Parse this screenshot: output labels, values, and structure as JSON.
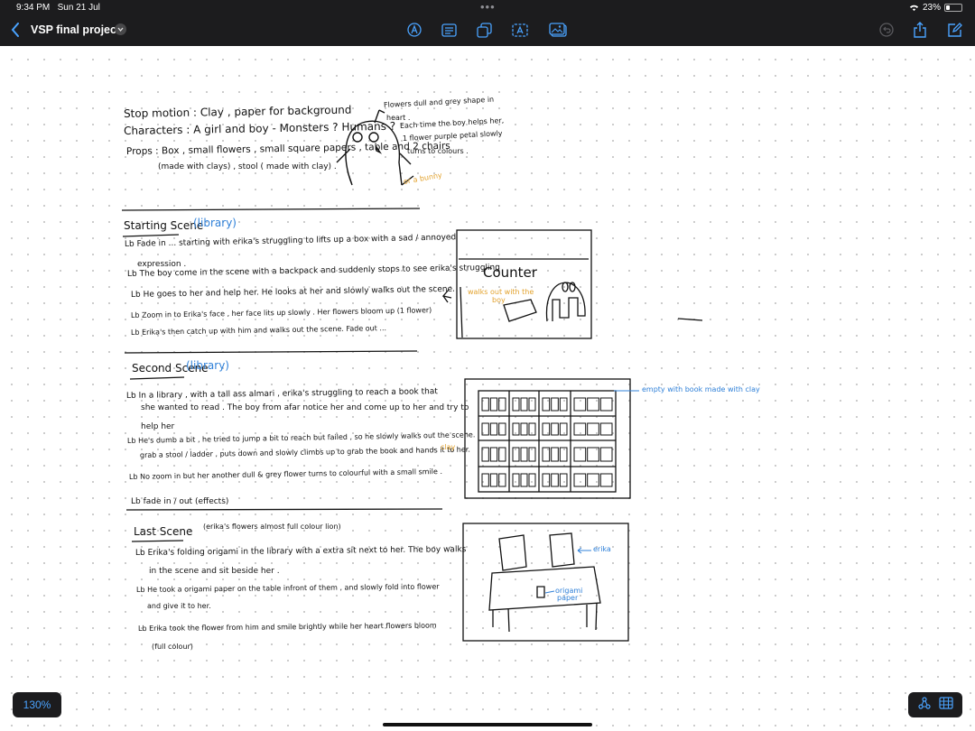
{
  "status_bar": {
    "time": "9:34 PM",
    "date": "Sun 21 Jul",
    "dots": "•••",
    "battery": "23%",
    "battery_level": 0.23
  },
  "toolbar": {
    "back_icon": "chevron-left-icon",
    "title": "VSP final project",
    "tools": [
      "pen-tip-icon",
      "text-format-icon",
      "shapes-icon",
      "text-box-icon",
      "media-icon"
    ],
    "right": [
      "undo-icon",
      "share-icon",
      "compose-icon"
    ]
  },
  "note": {
    "header": {
      "line1": "Stop motion : Clay , paper for background",
      "line2": "Characters : A girl and boy - Monsters ? Humans ?",
      "line3": "Props : Box , small flowers , small square papers , table and 2 chairs",
      "line4": "(made with clays) , stool ( made with clay) .",
      "monster_note1": "Flowers dull and grey shape in",
      "monster_note2": "heart .",
      "monster_note3": "Each time the boy helps her,",
      "monster_note4": "1 flower purple petal slowly",
      "monster_note5": "turns to colours .",
      "or_bunny": "or a bunny"
    },
    "scene1": {
      "title": "Starting Scene",
      "tag": "(library)",
      "b1a": "Lb Fade in ... starting with erika's struggling to lifts up a box with a sad / annoyed",
      "b1b": "expression .",
      "b2": "Lb The boy come in the scene with a backpack and suddenly stops to see erika's struggling",
      "b3": "Lb He goes to her and help her. He looks at her and slowly walks out the scene.",
      "b4": "Lb Zoom in to Erika's face , her face lits up slowly . Her flowers bloom up (1 flower)",
      "b5": "Lb Erika's then catch up with him and walks out the scene. Fade out ...",
      "sketch_counter": "Counter",
      "sketch_walks1": "walks out with the",
      "sketch_walks2": "boy"
    },
    "scene2": {
      "title": "Second Scene",
      "tag": "(library)",
      "b1a": "Lb In a library , with a tall ass almari , erika's struggling to reach a book that",
      "b1b": "she wanted to read . The boy from afar notice her and come up to her and try to",
      "b1c": "help her",
      "b2a": "Lb He's dumb a bit , he tried to jump a bit to reach but failed , so he slowly walks out the scene.",
      "b2b": "grab a stool / ladder , puts down and slowly climbs up to grab the book and hands it to her.",
      "b2_clay": "clay",
      "b3": "Lb No zoom in but her another dull & grey flower turns to colourful with a small smile .",
      "b4": "Lb fade in / out (effects)",
      "empty_note": "empty with book made with clay"
    },
    "scene3": {
      "title": "Last Scene",
      "tag": "(erika's flowers almost full colour lion)",
      "b1a": "Lb Erika's folding origami in the library with a extra sit next to her. The boy walks",
      "b1b": "in the scene and sit beside her .",
      "b2a": "Lb He took a origami paper on the table infront of them , and slowly fold into flower",
      "b2b": "and give it to her.",
      "b3a": "Lb Erika took the flower from him and smile brightly while her heart flowers bloom",
      "b3b": "(full colour)",
      "erika_label": "erika",
      "origami1": "origami",
      "origami2": "paper"
    }
  },
  "bottom": {
    "zoom": "130%",
    "tools": [
      "lasso-icon",
      "keyboard-grid-icon"
    ]
  }
}
